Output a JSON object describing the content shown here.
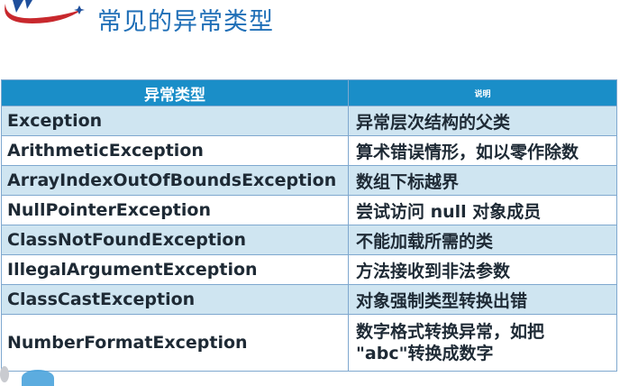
{
  "slide": {
    "title": "常见的异常类型"
  },
  "table": {
    "headers": {
      "type": "异常类型",
      "desc": "说明"
    },
    "rows": [
      {
        "type": "Exception",
        "desc": "异常层次结构的父类"
      },
      {
        "type": "ArithmeticException",
        "desc": "算术错误情形，如以零作除数"
      },
      {
        "type": "ArrayIndexOutOfBoundsException",
        "desc": "数组下标越界"
      },
      {
        "type": "NullPointerException",
        "desc": "尝试访问 null 对象成员"
      },
      {
        "type": "ClassNotFoundException",
        "desc": "不能加载所需的类"
      },
      {
        "type": "IllegalArgumentException",
        "desc": "方法接收到非法参数"
      },
      {
        "type": "ClassCastException",
        "desc": "对象强制类型转换出错"
      },
      {
        "type": "NumberFormatException",
        "desc": "数字格式转换异常，如把 \"abc\"转换成数字"
      }
    ]
  },
  "colors": {
    "title": "#1f6fb7",
    "header_bg": "#1a8ec8",
    "row_stripe": "#cfe5f1",
    "logo_red": "#c8282d",
    "logo_blue": "#1e4f9c"
  },
  "icons": {
    "logo": "logo-swoosh-icon"
  }
}
